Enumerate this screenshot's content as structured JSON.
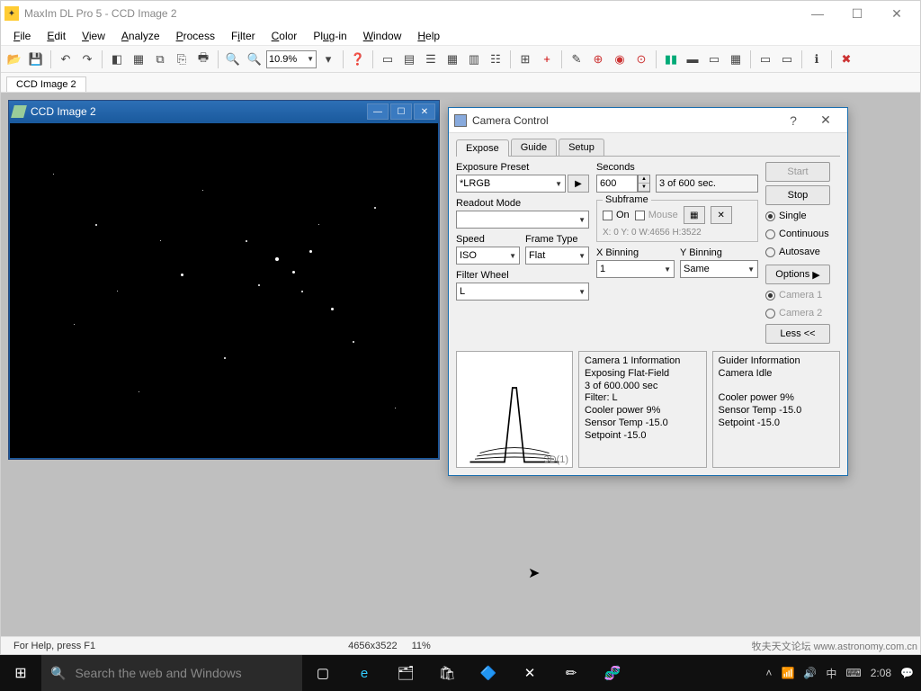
{
  "app": {
    "title": "MaxIm DL Pro 5 - CCD Image 2"
  },
  "menu": {
    "file": "File",
    "edit": "Edit",
    "view": "View",
    "analyze": "Analyze",
    "process": "Process",
    "filter": "Filter",
    "color": "Color",
    "plugin": "Plug-in",
    "window": "Window",
    "help": "Help"
  },
  "toolbar": {
    "zoom": "10.9%"
  },
  "doc_tab": "CCD Image 2",
  "child": {
    "title": "CCD Image 2"
  },
  "camera": {
    "title": "Camera Control",
    "tabs": {
      "expose": "Expose",
      "guide": "Guide",
      "setup": "Setup"
    },
    "labels": {
      "exposure_preset": "Exposure Preset",
      "seconds": "Seconds",
      "readout": "Readout Mode",
      "speed": "Speed",
      "frame_type": "Frame Type",
      "filter_wheel": "Filter Wheel",
      "xbin": "X Binning",
      "ybin": "Y Binning",
      "subframe": "Subframe",
      "on": "On",
      "mouse": "Mouse",
      "options": "Options",
      "less": "Less <<"
    },
    "values": {
      "preset": "*LRGB",
      "seconds": "600",
      "progress": "3 of 600 sec.",
      "speed": "ISO",
      "frame_type": "Flat",
      "filter": "L",
      "xbin": "1",
      "ybin": "Same",
      "subframe_coords": "X: 0 Y: 0 W:4656 H:3522"
    },
    "buttons": {
      "start": "Start",
      "stop": "Stop"
    },
    "radio": {
      "single": "Single",
      "continuous": "Continuous",
      "autosave": "Autosave",
      "cam1": "Camera 1",
      "cam2": "Camera 2"
    },
    "info1": {
      "title": "Camera 1 Information",
      "l1": "Exposing Flat-Field",
      "l2": "3 of 600.000 sec",
      "l3": "Filter: L",
      "l4": "Cooler power 9%",
      "l5": "Sensor Temp -15.0",
      "l6": "Setpoint -15.0"
    },
    "info2": {
      "title": "Guider Information",
      "l1": "Camera Idle",
      "l2": "Cooler power 9%",
      "l3": "Sensor Temp -15.0",
      "l4": "Setpoint -15.0"
    },
    "profile": "3D(1)"
  },
  "status": {
    "help": "For Help, press F1",
    "dim": "4656x3522",
    "zoom": "11%"
  },
  "taskbar": {
    "search": "Search the web and Windows",
    "time": "2:08"
  },
  "watermark": "牧夫天文论坛 www.astronomy.com.cn"
}
